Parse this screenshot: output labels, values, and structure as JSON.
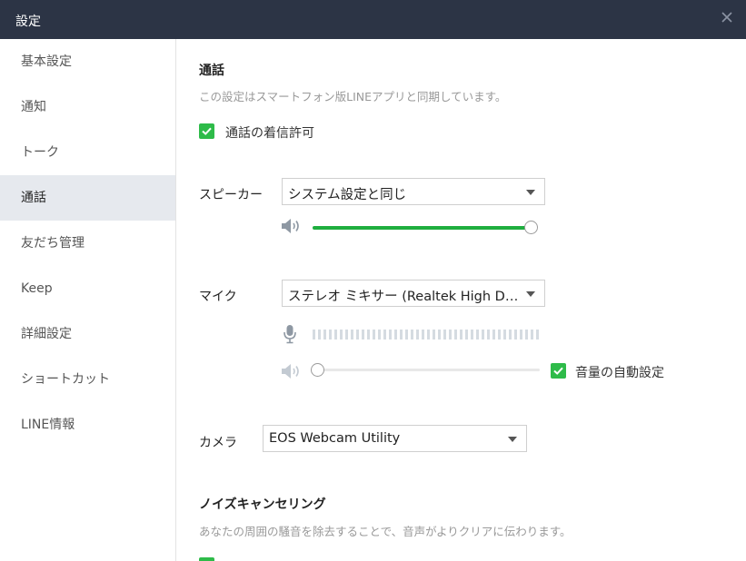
{
  "window": {
    "title": "設定",
    "close_icon": "close-icon"
  },
  "sidebar": {
    "items": [
      {
        "label": "基本設定",
        "active": false
      },
      {
        "label": "通知",
        "active": false
      },
      {
        "label": "トーク",
        "active": false
      },
      {
        "label": "通話",
        "active": true
      },
      {
        "label": "友だち管理",
        "active": false
      },
      {
        "label": "Keep",
        "active": false
      },
      {
        "label": "詳細設定",
        "active": false
      },
      {
        "label": "ショートカット",
        "active": false
      },
      {
        "label": "LINE情報",
        "active": false
      }
    ]
  },
  "call": {
    "title": "通話",
    "description": "この設定はスマートフォン版LINEアプリと同期しています。",
    "allow_incoming": {
      "label": "通話の着信許可",
      "checked": true
    }
  },
  "speaker": {
    "label": "スピーカー",
    "device": "システム設定と同じ",
    "volume_percent": 100
  },
  "mic": {
    "label": "マイク",
    "device": "ステレオ ミキサー (Realtek High Defini...",
    "input_level_percent": 0,
    "volume_percent": 0,
    "auto_volume": {
      "label": "音量の自動設定",
      "checked": true
    }
  },
  "camera": {
    "label": "カメラ",
    "device": "EOS Webcam Utility"
  },
  "noise": {
    "title": "ノイズキャンセリング",
    "description": "あなたの周囲の騒音を除去することで、音声がよりクリアに伝わります。",
    "checked": true
  },
  "colors": {
    "accent": "#2ebb49",
    "slider_fill": "#1fae3f",
    "titlebar": "#2c3445",
    "sidebar_active": "#e6e9ee"
  }
}
